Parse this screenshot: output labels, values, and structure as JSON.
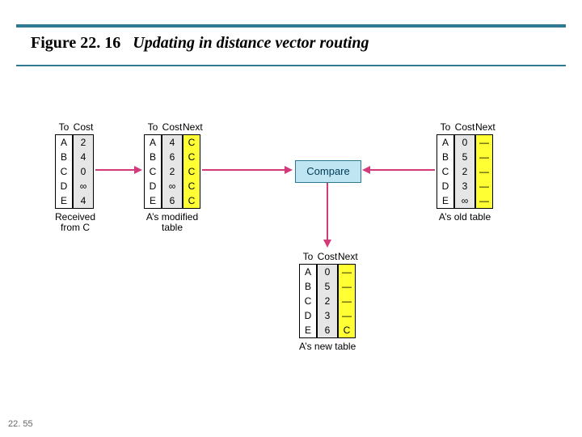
{
  "figure_number": "Figure 22. 16",
  "figure_caption": "Updating in distance vector routing",
  "slide_number": "22. 55",
  "headers": {
    "to": "To",
    "cost": "Cost",
    "next": "Next"
  },
  "compare_label": "Compare",
  "tables": {
    "received": {
      "caption_l1": "Received",
      "caption_l2": "from C",
      "rows": [
        {
          "to": "A",
          "cost": "2"
        },
        {
          "to": "B",
          "cost": "4"
        },
        {
          "to": "C",
          "cost": "0"
        },
        {
          "to": "D",
          "cost": "∞"
        },
        {
          "to": "E",
          "cost": "4"
        }
      ]
    },
    "modified": {
      "caption_l1": "A’s modified",
      "caption_l2": "table",
      "rows": [
        {
          "to": "A",
          "cost": "4",
          "next": "C"
        },
        {
          "to": "B",
          "cost": "6",
          "next": "C"
        },
        {
          "to": "C",
          "cost": "2",
          "next": "C"
        },
        {
          "to": "D",
          "cost": "∞",
          "next": "C"
        },
        {
          "to": "E",
          "cost": "6",
          "next": "C"
        }
      ]
    },
    "old": {
      "caption_l1": "A’s old table",
      "rows": [
        {
          "to": "A",
          "cost": "0",
          "next": "—"
        },
        {
          "to": "B",
          "cost": "5",
          "next": "—"
        },
        {
          "to": "C",
          "cost": "2",
          "next": "—"
        },
        {
          "to": "D",
          "cost": "3",
          "next": "—"
        },
        {
          "to": "E",
          "cost": "∞",
          "next": "—"
        }
      ]
    },
    "new": {
      "caption_l1": "A’s new table",
      "rows": [
        {
          "to": "A",
          "cost": "0",
          "next": "—"
        },
        {
          "to": "B",
          "cost": "5",
          "next": "—"
        },
        {
          "to": "C",
          "cost": "2",
          "next": "—"
        },
        {
          "to": "D",
          "cost": "3",
          "next": "—"
        },
        {
          "to": "E",
          "cost": "6",
          "next": "C"
        }
      ]
    }
  }
}
